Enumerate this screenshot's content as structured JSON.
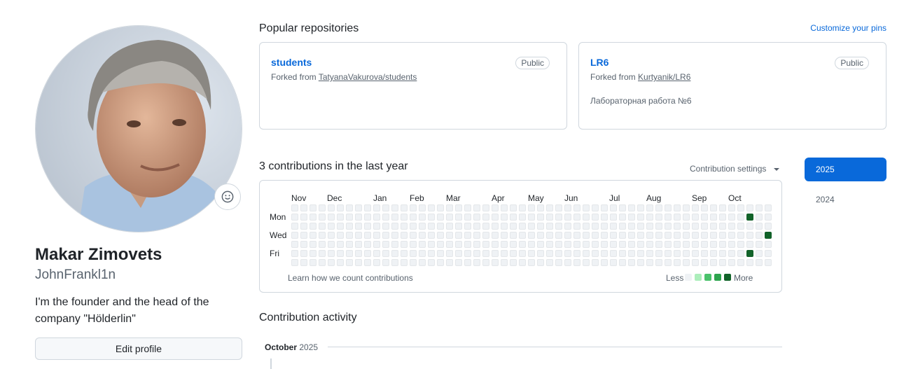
{
  "profile": {
    "display_name": "Makar Zimovets",
    "login": "JohnFrankl1n",
    "bio": "I'm the founder and the head of the company \"Hölderlin\"",
    "edit_button": "Edit profile",
    "avatar_icon": "person-avatar-photo",
    "status_icon": "smiley-icon"
  },
  "pinned": {
    "title": "Popular repositories",
    "customize_label": "Customize your pins",
    "repos": [
      {
        "name": "students",
        "visibility": "Public",
        "forked_prefix": "Forked from",
        "forked_from": "TatyanaVakurova/students",
        "description": ""
      },
      {
        "name": "LR6",
        "visibility": "Public",
        "forked_prefix": "Forked from",
        "forked_from": "Kurtyanik/LR6",
        "description": "Лабораторная работа №6"
      }
    ]
  },
  "contributions": {
    "title": "3 contributions in the last year",
    "settings_label": "Contribution settings",
    "months": [
      "Nov",
      "Dec",
      "Jan",
      "Feb",
      "Mar",
      "Apr",
      "May",
      "Jun",
      "Jul",
      "Aug",
      "Sep",
      "Oct"
    ],
    "days": [
      "Mon",
      "Wed",
      "Fri"
    ],
    "learn_label": "Learn how we count contributions",
    "legend_less": "Less",
    "legend_more": "More",
    "weeks": 53,
    "active_days": [
      {
        "week": 50,
        "weekday": 1,
        "level": 4
      },
      {
        "week": 50,
        "weekday": 5,
        "level": 4
      },
      {
        "week": 52,
        "weekday": 3,
        "level": 4
      }
    ],
    "colors": {
      "empty": "#eff2f5",
      "l1": "#aceebb",
      "l2": "#4ac26b",
      "l3": "#2da44e",
      "l4": "#116329"
    },
    "years": [
      "2025",
      "2024"
    ],
    "selected_year": "2025"
  },
  "activity": {
    "title": "Contribution activity",
    "month": "October",
    "year": "2025"
  }
}
